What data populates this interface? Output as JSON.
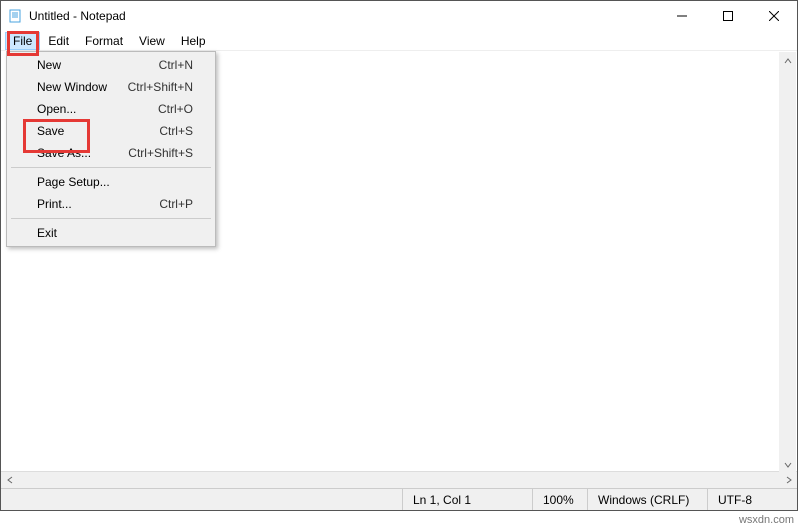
{
  "title": "Untitled - Notepad",
  "menu": {
    "file": "File",
    "edit": "Edit",
    "format": "Format",
    "view": "View",
    "help": "Help"
  },
  "file_menu": {
    "new": {
      "label": "New",
      "shortcut": "Ctrl+N"
    },
    "new_window": {
      "label": "New Window",
      "shortcut": "Ctrl+Shift+N"
    },
    "open": {
      "label": "Open...",
      "shortcut": "Ctrl+O"
    },
    "save": {
      "label": "Save",
      "shortcut": "Ctrl+S"
    },
    "save_as": {
      "label": "Save As...",
      "shortcut": "Ctrl+Shift+S"
    },
    "page_setup": {
      "label": "Page Setup...",
      "shortcut": ""
    },
    "print": {
      "label": "Print...",
      "shortcut": "Ctrl+P"
    },
    "exit": {
      "label": "Exit",
      "shortcut": ""
    }
  },
  "status": {
    "position": "Ln 1, Col 1",
    "zoom": "100%",
    "line_ending": "Windows (CRLF)",
    "encoding": "UTF-8"
  },
  "editor_value": "",
  "watermark": "wsxdn.com"
}
